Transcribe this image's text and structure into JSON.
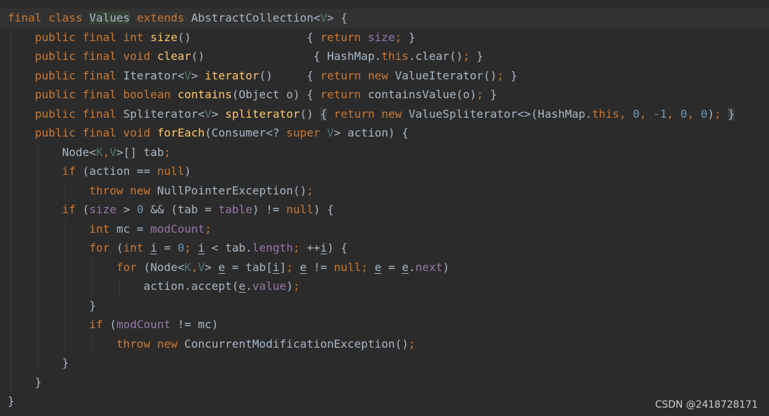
{
  "editor": {
    "language": "java",
    "theme": "darcula",
    "colors": {
      "background": "#2b2b2b",
      "text": "#a9b7c6",
      "keyword": "#cc7832",
      "method": "#ffc66d",
      "field": "#9876aa",
      "number": "#6897bb",
      "type_param": "#507874"
    }
  },
  "code": {
    "lines": [
      [
        {
          "t": "final class ",
          "c": "kw"
        },
        {
          "t": "Values",
          "c": "hl-class"
        },
        {
          "t": " "
        },
        {
          "t": "extends ",
          "c": "kw"
        },
        {
          "t": "AbstractCollection<"
        },
        {
          "t": "V",
          "c": "tp"
        },
        {
          "t": "> {"
        }
      ],
      [
        {
          "t": "    "
        },
        {
          "t": "public final int ",
          "c": "kw"
        },
        {
          "t": "size",
          "c": "fn"
        },
        {
          "t": "()                 { "
        },
        {
          "t": "return ",
          "c": "kw"
        },
        {
          "t": "size",
          "c": "fld"
        },
        {
          "t": "; ",
          "c": "kw"
        },
        {
          "t": "}"
        }
      ],
      [
        {
          "t": "    "
        },
        {
          "t": "public final void ",
          "c": "kw"
        },
        {
          "t": "clear",
          "c": "fn"
        },
        {
          "t": "()                { HashMap."
        },
        {
          "t": "this",
          "c": "kw"
        },
        {
          "t": ".clear()"
        },
        {
          "t": "; ",
          "c": "kw"
        },
        {
          "t": "}"
        }
      ],
      [
        {
          "t": "    "
        },
        {
          "t": "public final ",
          "c": "kw"
        },
        {
          "t": "Iterator<"
        },
        {
          "t": "V",
          "c": "tp"
        },
        {
          "t": "> "
        },
        {
          "t": "iterator",
          "c": "fn"
        },
        {
          "t": "()     { "
        },
        {
          "t": "return new ",
          "c": "kw"
        },
        {
          "t": "ValueIterator()"
        },
        {
          "t": "; ",
          "c": "kw"
        },
        {
          "t": "}"
        }
      ],
      [
        {
          "t": "    "
        },
        {
          "t": "public final boolean ",
          "c": "kw"
        },
        {
          "t": "contains",
          "c": "fn"
        },
        {
          "t": "(Object o) { "
        },
        {
          "t": "return ",
          "c": "kw"
        },
        {
          "t": "containsValue(o)"
        },
        {
          "t": "; ",
          "c": "kw"
        },
        {
          "t": "}"
        }
      ],
      [
        {
          "t": "    "
        },
        {
          "t": "public final ",
          "c": "kw"
        },
        {
          "t": "Spliterator<"
        },
        {
          "t": "V",
          "c": "tp"
        },
        {
          "t": "> "
        },
        {
          "t": "spliterator",
          "c": "fn"
        },
        {
          "t": "() "
        },
        {
          "t": "{",
          "c": "brace-hl"
        },
        {
          "t": " "
        },
        {
          "t": "return new ",
          "c": "kw"
        },
        {
          "t": "ValueSpliterator<>(HashMap."
        },
        {
          "t": "this",
          "c": "kw"
        },
        {
          "t": ", ",
          "c": "kw"
        },
        {
          "t": "0",
          "c": "num"
        },
        {
          "t": ", ",
          "c": "kw"
        },
        {
          "t": "-1",
          "c": "num"
        },
        {
          "t": ", ",
          "c": "kw"
        },
        {
          "t": "0",
          "c": "num"
        },
        {
          "t": ", ",
          "c": "kw"
        },
        {
          "t": "0",
          "c": "num"
        },
        {
          "t": ")"
        },
        {
          "t": "; ",
          "c": "kw"
        },
        {
          "t": "}",
          "c": "brace-hl"
        }
      ],
      [
        {
          "t": "    "
        },
        {
          "t": "public final void ",
          "c": "kw"
        },
        {
          "t": "forEach",
          "c": "fn"
        },
        {
          "t": "(Consumer<? "
        },
        {
          "t": "super ",
          "c": "kw"
        },
        {
          "t": "V",
          "c": "tp"
        },
        {
          "t": "> action) {"
        }
      ],
      [
        {
          "t": "        Node<"
        },
        {
          "t": "K",
          "c": "tp"
        },
        {
          "t": ",",
          "c": "kw"
        },
        {
          "t": "V",
          "c": "tp"
        },
        {
          "t": ">[] tab"
        },
        {
          "t": ";",
          "c": "kw"
        }
      ],
      [
        {
          "t": "        "
        },
        {
          "t": "if ",
          "c": "kw"
        },
        {
          "t": "(action == "
        },
        {
          "t": "null",
          "c": "kw"
        },
        {
          "t": ")"
        }
      ],
      [
        {
          "t": "            "
        },
        {
          "t": "throw new ",
          "c": "kw"
        },
        {
          "t": "NullPointerException()"
        },
        {
          "t": ";",
          "c": "kw"
        }
      ],
      [
        {
          "t": "        "
        },
        {
          "t": "if ",
          "c": "kw"
        },
        {
          "t": "("
        },
        {
          "t": "size ",
          "c": "fld"
        },
        {
          "t": "> "
        },
        {
          "t": "0 ",
          "c": "num"
        },
        {
          "t": "&& (tab = "
        },
        {
          "t": "table",
          "c": "fld"
        },
        {
          "t": ") != "
        },
        {
          "t": "null",
          "c": "kw"
        },
        {
          "t": ") {"
        }
      ],
      [
        {
          "t": "            "
        },
        {
          "t": "int ",
          "c": "kw"
        },
        {
          "t": "mc = "
        },
        {
          "t": "modCount",
          "c": "fld"
        },
        {
          "t": ";",
          "c": "kw"
        }
      ],
      [
        {
          "t": "            "
        },
        {
          "t": "for ",
          "c": "kw"
        },
        {
          "t": "("
        },
        {
          "t": "int ",
          "c": "kw"
        },
        {
          "t": "i",
          "c": "u"
        },
        {
          "t": " = "
        },
        {
          "t": "0",
          "c": "num"
        },
        {
          "t": "; ",
          "c": "kw"
        },
        {
          "t": "i",
          "c": "u"
        },
        {
          "t": " < tab."
        },
        {
          "t": "length",
          "c": "fld"
        },
        {
          "t": "; ",
          "c": "kw"
        },
        {
          "t": "++"
        },
        {
          "t": "i",
          "c": "u"
        },
        {
          "t": ") {"
        }
      ],
      [
        {
          "t": "                "
        },
        {
          "t": "for ",
          "c": "kw"
        },
        {
          "t": "(Node<"
        },
        {
          "t": "K",
          "c": "tp"
        },
        {
          "t": ",",
          "c": "kw"
        },
        {
          "t": "V",
          "c": "tp"
        },
        {
          "t": "> "
        },
        {
          "t": "e",
          "c": "u"
        },
        {
          "t": " = tab["
        },
        {
          "t": "i",
          "c": "u"
        },
        {
          "t": "]"
        },
        {
          "t": "; ",
          "c": "kw"
        },
        {
          "t": "e",
          "c": "u"
        },
        {
          "t": " != "
        },
        {
          "t": "null",
          "c": "kw"
        },
        {
          "t": "; ",
          "c": "kw"
        },
        {
          "t": "e",
          "c": "u"
        },
        {
          "t": " = "
        },
        {
          "t": "e",
          "c": "u"
        },
        {
          "t": "."
        },
        {
          "t": "next",
          "c": "fld"
        },
        {
          "t": ")"
        }
      ],
      [
        {
          "t": "                    action.accept("
        },
        {
          "t": "e",
          "c": "u"
        },
        {
          "t": "."
        },
        {
          "t": "value",
          "c": "fld"
        },
        {
          "t": ")"
        },
        {
          "t": ";",
          "c": "kw"
        }
      ],
      [
        {
          "t": "            }"
        }
      ],
      [
        {
          "t": "            "
        },
        {
          "t": "if ",
          "c": "kw"
        },
        {
          "t": "("
        },
        {
          "t": "modCount ",
          "c": "fld"
        },
        {
          "t": "!= mc)"
        }
      ],
      [
        {
          "t": "                "
        },
        {
          "t": "throw new ",
          "c": "kw"
        },
        {
          "t": "ConcurrentModificationException()"
        },
        {
          "t": ";",
          "c": "kw"
        }
      ],
      [
        {
          "t": "        }"
        }
      ],
      [
        {
          "t": "    }"
        }
      ],
      [
        {
          "t": "}"
        }
      ]
    ]
  },
  "watermark": {
    "text": "CSDN @2418728171"
  }
}
